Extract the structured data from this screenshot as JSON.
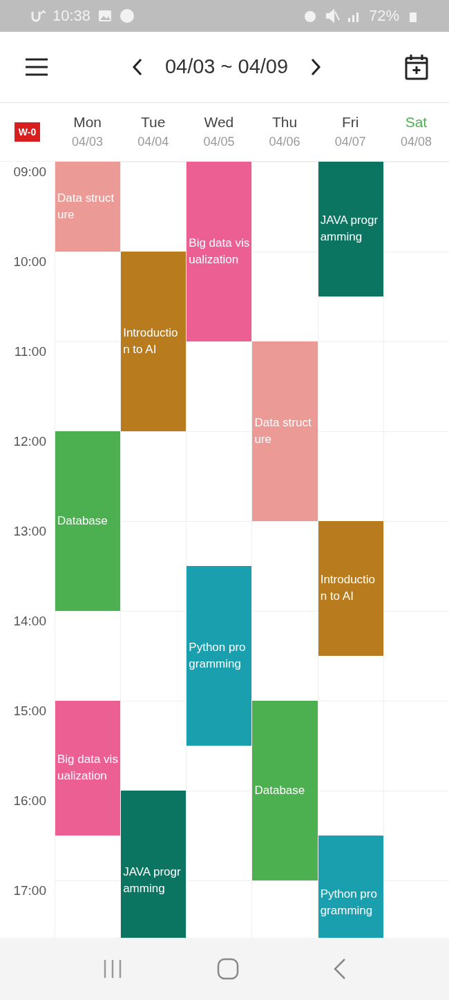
{
  "status_bar": {
    "time": "10:38",
    "battery": "72%"
  },
  "header": {
    "range": "04/03 ~ 04/09"
  },
  "week_badge": "W-0",
  "hours": [
    "09:00",
    "10:00",
    "11:00",
    "12:00",
    "13:00",
    "14:00",
    "15:00",
    "16:00",
    "17:00"
  ],
  "days": [
    {
      "name": "Mon",
      "date": "04/03",
      "kind": "weekday",
      "half_hours": [
        {
          "kind": "class",
          "title": "Data structure",
          "color": "#ec9a95"
        },
        {
          "kind": "continued"
        },
        {
          "kind": "empty"
        },
        {
          "kind": "empty"
        },
        {
          "kind": "empty"
        },
        {
          "kind": "empty"
        },
        {
          "kind": "class",
          "title": "Database",
          "color": "#4caf50"
        },
        {
          "kind": "continued"
        },
        {
          "kind": "continued"
        },
        {
          "kind": "continued"
        },
        {
          "kind": "empty"
        },
        {
          "kind": "empty"
        },
        {
          "kind": "class",
          "title": "Big data visualization",
          "color": "#ec5f92"
        },
        {
          "kind": "continued"
        },
        {
          "kind": "continued"
        }
      ]
    },
    {
      "name": "Tue",
      "date": "04/04",
      "kind": "weekday",
      "half_hours": [
        {
          "kind": "empty"
        },
        {
          "kind": "empty"
        },
        {
          "kind": "class",
          "title": "Introduction to AI",
          "color": "#b87c1e"
        },
        {
          "kind": "continued"
        },
        {
          "kind": "continued"
        },
        {
          "kind": "continued"
        },
        {
          "kind": "empty"
        },
        {
          "kind": "empty"
        },
        {
          "kind": "empty"
        },
        {
          "kind": "empty"
        },
        {
          "kind": "empty"
        },
        {
          "kind": "empty"
        },
        {
          "kind": "empty"
        },
        {
          "kind": "empty"
        },
        {
          "kind": "class",
          "title": "JAVA programming",
          "color": "#0b7561"
        },
        {
          "kind": "continued"
        },
        {
          "kind": "continued"
        },
        {
          "kind": "continued"
        }
      ]
    },
    {
      "name": "Wed",
      "date": "04/05",
      "kind": "weekday",
      "half_hours": [
        {
          "kind": "class",
          "title": "Big data visualization",
          "color": "#ec5f92"
        },
        {
          "kind": "continued"
        },
        {
          "kind": "continued"
        },
        {
          "kind": "continued"
        },
        {
          "kind": "empty"
        },
        {
          "kind": "empty"
        },
        {
          "kind": "empty"
        },
        {
          "kind": "empty"
        },
        {
          "kind": "empty"
        },
        {
          "kind": "class",
          "title": "Python programming",
          "color": "#1a9fae"
        },
        {
          "kind": "continued"
        },
        {
          "kind": "continued"
        },
        {
          "kind": "continued"
        }
      ]
    },
    {
      "name": "Thu",
      "date": "04/06",
      "kind": "weekday",
      "half_hours": [
        {
          "kind": "empty"
        },
        {
          "kind": "empty"
        },
        {
          "kind": "empty"
        },
        {
          "kind": "empty"
        },
        {
          "kind": "class",
          "title": "Data structure",
          "color": "#ec9a95"
        },
        {
          "kind": "continued"
        },
        {
          "kind": "continued"
        },
        {
          "kind": "continued"
        },
        {
          "kind": "empty"
        },
        {
          "kind": "empty"
        },
        {
          "kind": "empty"
        },
        {
          "kind": "empty"
        },
        {
          "kind": "class",
          "title": "Database",
          "color": "#4caf50"
        },
        {
          "kind": "continued"
        },
        {
          "kind": "continued"
        },
        {
          "kind": "continued"
        }
      ]
    },
    {
      "name": "Fri",
      "date": "04/07",
      "kind": "weekday",
      "half_hours": [
        {
          "kind": "class",
          "title": "JAVA programming",
          "color": "#0b7561"
        },
        {
          "kind": "continued"
        },
        {
          "kind": "continued"
        },
        {
          "kind": "empty"
        },
        {
          "kind": "empty"
        },
        {
          "kind": "empty"
        },
        {
          "kind": "empty"
        },
        {
          "kind": "empty"
        },
        {
          "kind": "class",
          "title": "Introduction to AI",
          "color": "#b87c1e"
        },
        {
          "kind": "continued"
        },
        {
          "kind": "continued"
        },
        {
          "kind": "empty"
        },
        {
          "kind": "empty"
        },
        {
          "kind": "empty"
        },
        {
          "kind": "empty"
        },
        {
          "kind": "class",
          "title": "Python programming",
          "color": "#1a9fae"
        },
        {
          "kind": "continued"
        },
        {
          "kind": "continued"
        }
      ]
    },
    {
      "name": "Sat",
      "date": "04/08",
      "kind": "saturday"
    }
  ]
}
